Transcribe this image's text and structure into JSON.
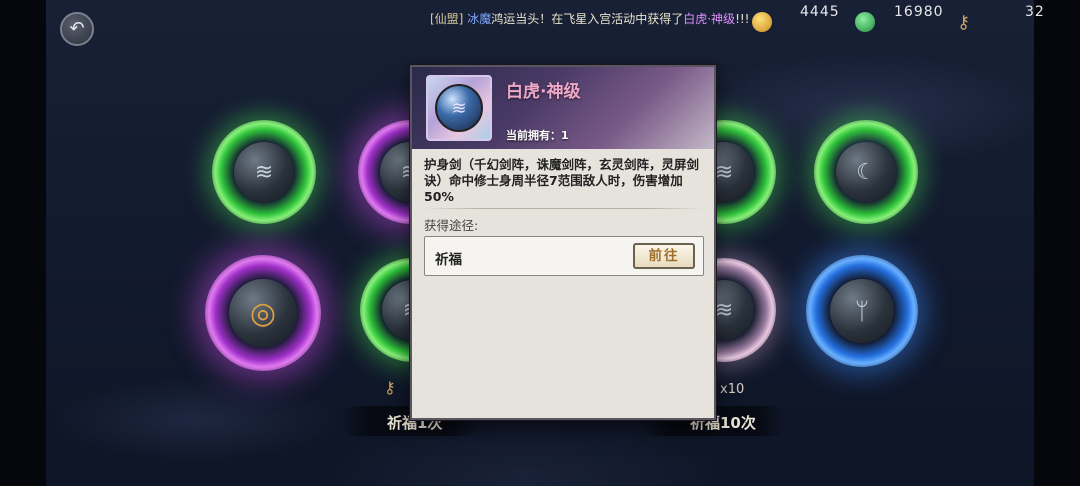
{
  "broadcast": {
    "tag": "[仙盟]",
    "player": "冰魔",
    "message_mid": "鸿运当头！在飞星入宫活动中获得了",
    "item": "白虎·神级",
    "suffix": "!!!"
  },
  "currencies": {
    "gold_value": "4445",
    "gem_value": "16980",
    "key_value": "32",
    "gold_icon": "gold-ingot-icon",
    "gem_icon": "green-gem-icon",
    "key_icon": "key-icon"
  },
  "draw": {
    "single_label": "祈福1次",
    "ten_label": "祈福10次",
    "ten_cost": "x10"
  },
  "popup": {
    "title": "白虎·神级",
    "owned_label": "当前拥有：",
    "owned_value": "1",
    "description": "护身剑（千幻剑阵，诛魔剑阵，玄灵剑阵，灵屏剑诀）命中修士身周半径7范围敌人时，伤害增加50%",
    "source_heading": "获得途径:",
    "source_name": "祈福",
    "goto_label": "前往"
  },
  "colors": {
    "title_pink": "#f0a8c8",
    "goto_gold": "#a0702a",
    "player_blue": "#7fa8ff",
    "item_purple": "#e090ff"
  }
}
